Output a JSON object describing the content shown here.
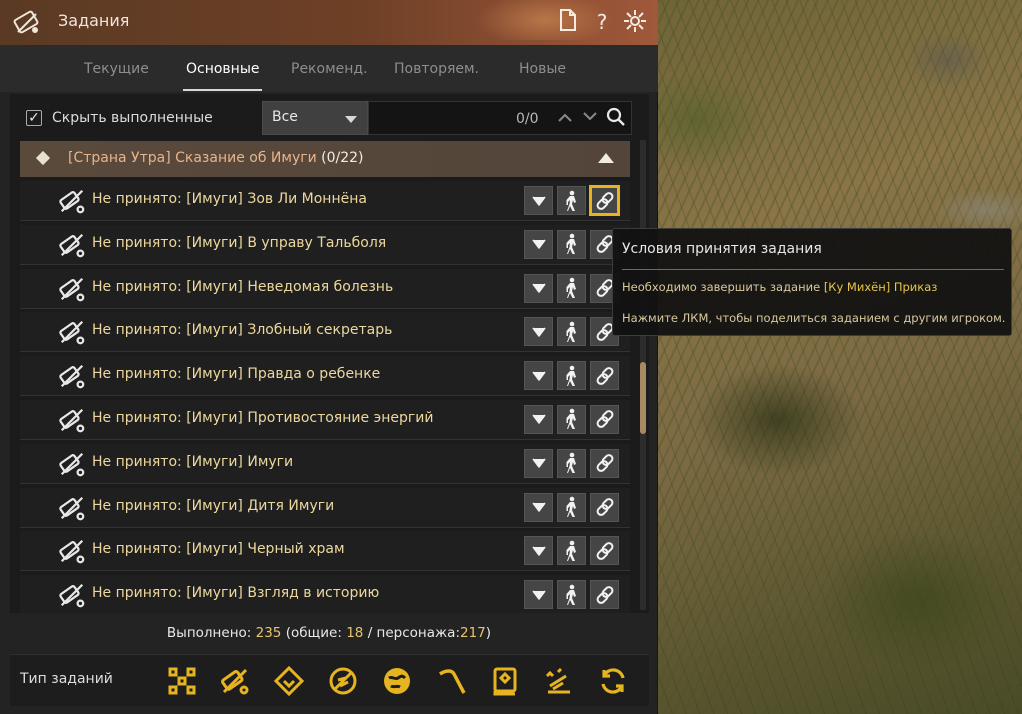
{
  "window": {
    "title": "Задания",
    "title_buttons": [
      {
        "name": "document-icon",
        "glyph": "🗋"
      },
      {
        "name": "help-icon",
        "glyph": "?"
      },
      {
        "name": "settings-icon",
        "glyph": "✵"
      }
    ]
  },
  "tabs": [
    "Текущие",
    "Основные",
    "Рекоменд.",
    "Повторяем.",
    "Новые"
  ],
  "active_tab": "Основные",
  "filter": {
    "hide_completed_label": "Скрыть выполненные",
    "hide_completed_checked": true,
    "select_value": "Все",
    "search_counter": "0/0"
  },
  "group": {
    "title": "[Страна Утра] Сказание об Имуги",
    "count": "(0/22)"
  },
  "quests": [
    "Не принято: [Имуги] Зов Ли Моннёна",
    "Не принято: [Имуги] В управу Тальболя",
    "Не принято: [Имуги] Неведомая болезнь",
    "Не принято: [Имуги] Злобный секретарь",
    "Не принято: [Имуги] Правда о ребенке",
    "Не принято: [Имуги] Противостояние энергий",
    "Не принято: [Имуги] Имуги",
    "Не принято: [Имуги] Дитя Имуги",
    "Не принято: [Имуги] Черный храм",
    "Не принято: [Имуги] Взгляд в историю"
  ],
  "footer": {
    "completed_label": "Выполнено:",
    "completed_value": "235",
    "common_label": "(общие:",
    "common_value": "18",
    "char_label": "/ персонажа:",
    "char_value": "217",
    "close_paren": ")"
  },
  "quest_types": {
    "label": "Тип заданий",
    "icons": [
      "all-types-icon",
      "story-quest-icon",
      "black-spirit-icon",
      "life-skill-icon",
      "world-icon",
      "gathering-icon",
      "knowledge-book-icon",
      "trade-icon",
      "repeatable-icon"
    ]
  },
  "tooltip": {
    "title": "Условия принятия задания",
    "line1_prefix": "Необходимо завершить задание",
    "line1_highlight": "[Ку Михён] Приказ",
    "line2": "Нажмите ЛКМ, чтобы поделиться заданием с другим игроком."
  },
  "colors": {
    "accent_gold": "#e6b420",
    "quest_text": "#ecd89e",
    "group_text": "#e8b48a",
    "scroll_thumb": "#a88a62"
  }
}
